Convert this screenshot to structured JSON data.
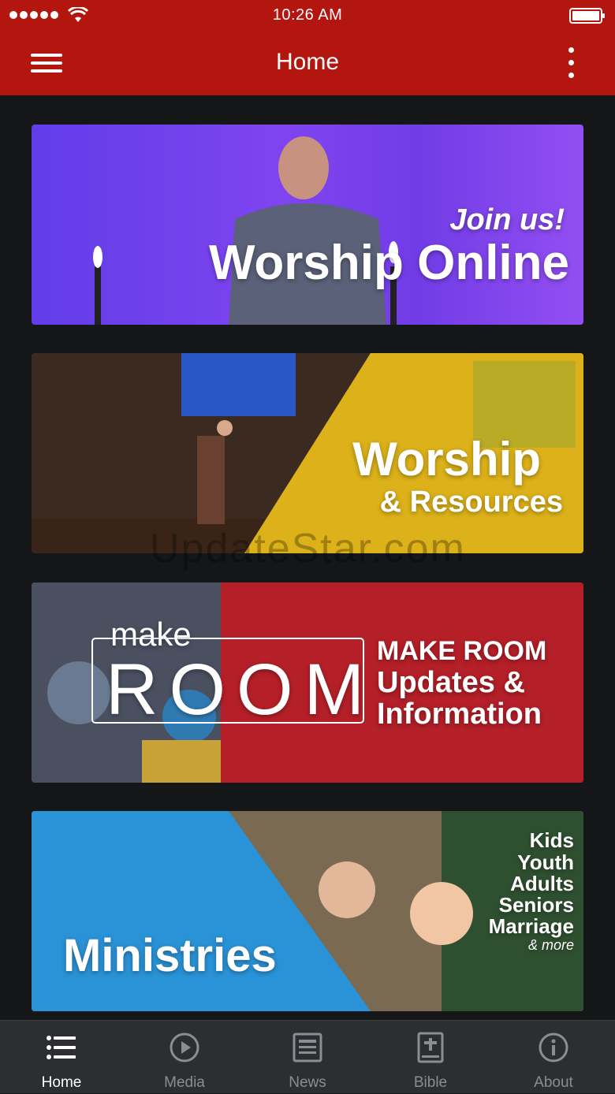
{
  "status_bar": {
    "time": "10:26 AM"
  },
  "nav": {
    "title": "Home",
    "menu_icon": "hamburger-icon",
    "more_icon": "vertical-dots-icon"
  },
  "tiles": [
    {
      "lines": [
        "Join us!",
        "Worship Online"
      ],
      "accent": "#6a3cf0"
    },
    {
      "lines": [
        "Worship",
        "& Resources"
      ],
      "accent": "#d8b21c"
    },
    {
      "logo_small": "make",
      "logo_big": "ROOM",
      "lines": [
        "MAKE ROOM",
        "Updates &",
        "Information"
      ],
      "accent": "#c0242a"
    },
    {
      "lines": [
        "Kids",
        "Youth",
        "Adults",
        "Seniors",
        "Marriage",
        "& more",
        "Ministries"
      ],
      "accent": "#2a8fcf"
    }
  ],
  "watermark": "UpdateStar.com",
  "tab_bar": {
    "active": "Home",
    "tabs": [
      {
        "label": "Home",
        "icon": "list-icon"
      },
      {
        "label": "Media",
        "icon": "play-circle-icon"
      },
      {
        "label": "News",
        "icon": "newspaper-icon"
      },
      {
        "label": "Bible",
        "icon": "bible-icon"
      },
      {
        "label": "About",
        "icon": "info-circle-icon"
      }
    ]
  }
}
